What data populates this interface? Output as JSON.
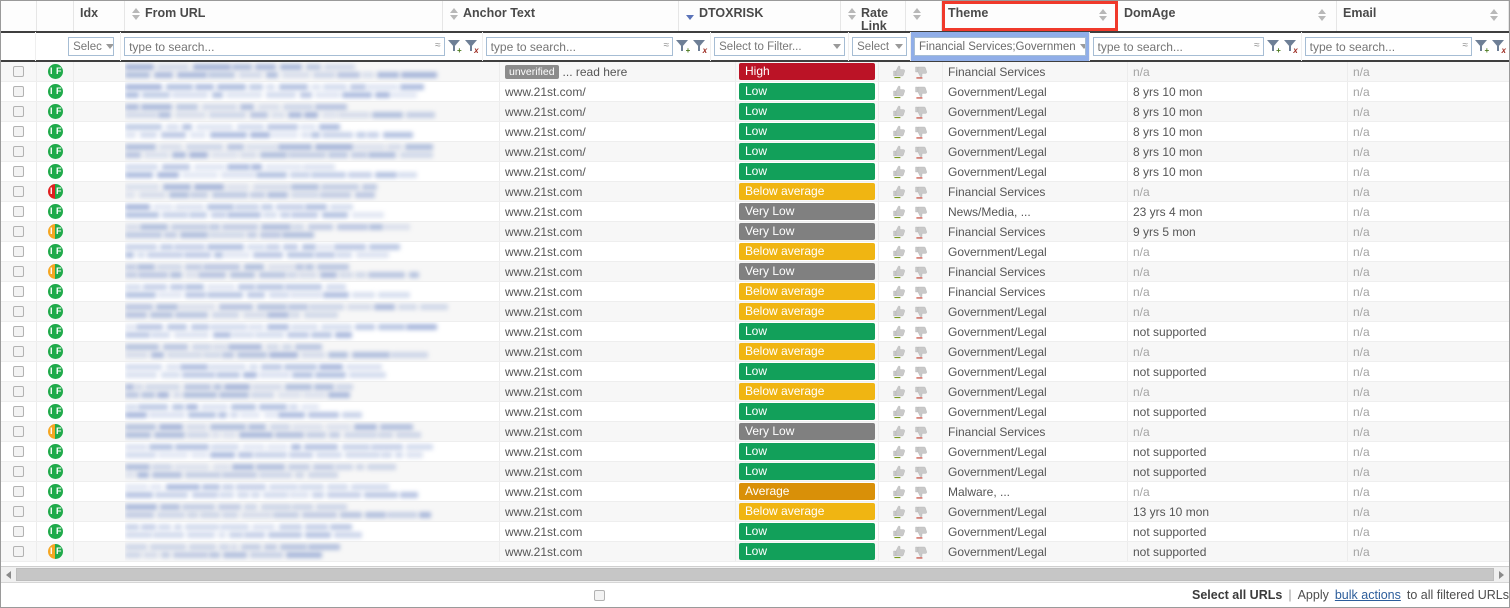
{
  "columns": [
    {
      "key": "select",
      "label": "",
      "width": 36,
      "sortable": false
    },
    {
      "key": "flags",
      "label": "",
      "width": 37,
      "sortable": false
    },
    {
      "key": "idx",
      "label": "Idx",
      "width": 0,
      "sortable": true
    },
    {
      "key": "from_url",
      "label": "From URL",
      "width": 0,
      "sortable": true
    },
    {
      "key": "anchor_text",
      "label": "Anchor Text",
      "width": 0,
      "sortable": true
    },
    {
      "key": "dtoxrisk",
      "label": "DTOXRISK",
      "width": 0,
      "sortable": true
    },
    {
      "key": "rate_link",
      "label": "Rate Link",
      "width": 0,
      "sortable": true
    },
    {
      "key": "theme",
      "label": "Theme",
      "width": 0,
      "sortable": true
    },
    {
      "key": "domage",
      "label": "DomAge",
      "width": 0,
      "sortable": true
    },
    {
      "key": "email",
      "label": "Email",
      "width": 0,
      "sortable": true
    }
  ],
  "header": {
    "idx_label": "Idx",
    "from_url_label": "From URL",
    "anchor_text_label": "Anchor Text",
    "dtoxrisk_label": "DTOXRISK",
    "rate_link_label": "Rate Link",
    "theme_label": "Theme",
    "domage_label": "DomAge",
    "email_label": "Email",
    "highlight_color": "#f0392b",
    "sorted_column": "DTOXRISK",
    "sort_direction": "desc"
  },
  "filters": {
    "idx_select": "Selec",
    "from_url_placeholder": "type to search...",
    "anchor_text_placeholder": "type to search...",
    "dtoxrisk_select": "Select to Filter...",
    "rate_link_select": "Select",
    "theme_select": "Financial Services;Governmen",
    "domage_placeholder": "type to search...",
    "email_placeholder": "type to search...",
    "fuzzy_glyph": "≈",
    "add_filter_mark": "+",
    "clear_filter_mark": "x"
  },
  "colors": {
    "risk_high": "#bb1326",
    "risk_low": "#12a05a",
    "risk_below_average": "#f0b512",
    "risk_very_low": "#808080",
    "risk_average": "#d99008",
    "flag_green": "#1faa4a",
    "flag_red": "#e02020",
    "flag_orange": "#f5a623",
    "theme_filter_bg": "#90aee8",
    "link": "#2c5d9b"
  },
  "rows": [
    {
      "flag_left": "green",
      "flag_right": "green",
      "url_blurred": true,
      "anchor_tag": "unverified",
      "anchor_text": "... read here",
      "dtoxrisk": "High",
      "risk_color": "#bb1326",
      "theme": "Financial Services",
      "domage": "n/a",
      "domage_muted": true,
      "email": "n/a"
    },
    {
      "flag_left": "green",
      "flag_right": "green",
      "url_blurred": true,
      "anchor_text": "www.21st.com/",
      "dtoxrisk": "Low",
      "risk_color": "#12a05a",
      "theme": "Government/Legal",
      "domage": "8 yrs 10 mon",
      "domage_muted": false,
      "email": "n/a"
    },
    {
      "flag_left": "green",
      "flag_right": "green",
      "url_blurred": true,
      "anchor_text": "www.21st.com/",
      "dtoxrisk": "Low",
      "risk_color": "#12a05a",
      "theme": "Government/Legal",
      "domage": "8 yrs 10 mon",
      "domage_muted": false,
      "email": "n/a"
    },
    {
      "flag_left": "green",
      "flag_right": "green",
      "url_blurred": true,
      "anchor_text": "www.21st.com/",
      "dtoxrisk": "Low",
      "risk_color": "#12a05a",
      "theme": "Government/Legal",
      "domage": "8 yrs 10 mon",
      "domage_muted": false,
      "email": "n/a"
    },
    {
      "flag_left": "green",
      "flag_right": "green",
      "url_blurred": true,
      "anchor_text": "www.21st.com/",
      "dtoxrisk": "Low",
      "risk_color": "#12a05a",
      "theme": "Government/Legal",
      "domage": "8 yrs 10 mon",
      "domage_muted": false,
      "email": "n/a"
    },
    {
      "flag_left": "green",
      "flag_right": "green",
      "url_blurred": true,
      "anchor_text": "www.21st.com/",
      "dtoxrisk": "Low",
      "risk_color": "#12a05a",
      "theme": "Government/Legal",
      "domage": "8 yrs 10 mon",
      "domage_muted": false,
      "email": "n/a"
    },
    {
      "flag_left": "red",
      "flag_right": "green",
      "url_blurred": true,
      "anchor_text": "www.21st.com",
      "dtoxrisk": "Below average",
      "risk_color": "#f0b512",
      "theme": "Financial Services",
      "domage": "n/a",
      "domage_muted": true,
      "email": "n/a"
    },
    {
      "flag_left": "green",
      "flag_right": "green",
      "url_blurred": true,
      "anchor_text": "www.21st.com",
      "dtoxrisk": "Very Low",
      "risk_color": "#808080",
      "theme": "News/Media, ...",
      "domage": "23 yrs 4 mon",
      "domage_muted": false,
      "email": "n/a"
    },
    {
      "flag_left": "orange",
      "flag_right": "green",
      "url_blurred": true,
      "anchor_text": "www.21st.com",
      "dtoxrisk": "Very Low",
      "risk_color": "#808080",
      "theme": "Financial Services",
      "domage": "9 yrs 5 mon",
      "domage_muted": false,
      "email": "n/a"
    },
    {
      "flag_left": "green",
      "flag_right": "green",
      "url_blurred": true,
      "anchor_text": "www.21st.com",
      "dtoxrisk": "Below average",
      "risk_color": "#f0b512",
      "theme": "Government/Legal",
      "domage": "n/a",
      "domage_muted": true,
      "email": "n/a"
    },
    {
      "flag_left": "orange",
      "flag_right": "green",
      "url_blurred": true,
      "anchor_text": "www.21st.com",
      "dtoxrisk": "Very Low",
      "risk_color": "#808080",
      "theme": "Financial Services",
      "domage": "n/a",
      "domage_muted": true,
      "email": "n/a"
    },
    {
      "flag_left": "green",
      "flag_right": "green",
      "url_blurred": true,
      "anchor_text": "www.21st.com",
      "dtoxrisk": "Below average",
      "risk_color": "#f0b512",
      "theme": "Financial Services",
      "domage": "n/a",
      "domage_muted": true,
      "email": "n/a"
    },
    {
      "flag_left": "green",
      "flag_right": "green",
      "url_blurred": true,
      "anchor_text": "www.21st.com",
      "dtoxrisk": "Below average",
      "risk_color": "#f0b512",
      "theme": "Government/Legal",
      "domage": "n/a",
      "domage_muted": true,
      "email": "n/a"
    },
    {
      "flag_left": "green",
      "flag_right": "green",
      "url_blurred": true,
      "anchor_text": "www.21st.com",
      "dtoxrisk": "Low",
      "risk_color": "#12a05a",
      "theme": "Government/Legal",
      "domage": "not supported",
      "domage_muted": false,
      "email": "n/a"
    },
    {
      "flag_left": "green",
      "flag_right": "green",
      "url_blurred": true,
      "anchor_text": "www.21st.com",
      "dtoxrisk": "Below average",
      "risk_color": "#f0b512",
      "theme": "Government/Legal",
      "domage": "n/a",
      "domage_muted": true,
      "email": "n/a"
    },
    {
      "flag_left": "green",
      "flag_right": "green",
      "url_blurred": true,
      "anchor_text": "www.21st.com",
      "dtoxrisk": "Low",
      "risk_color": "#12a05a",
      "theme": "Government/Legal",
      "domage": "not supported",
      "domage_muted": false,
      "email": "n/a"
    },
    {
      "flag_left": "green",
      "flag_right": "green",
      "url_blurred": true,
      "anchor_text": "www.21st.com",
      "dtoxrisk": "Below average",
      "risk_color": "#f0b512",
      "theme": "Government/Legal",
      "domage": "n/a",
      "domage_muted": true,
      "email": "n/a"
    },
    {
      "flag_left": "green",
      "flag_right": "green",
      "url_blurred": true,
      "anchor_text": "www.21st.com",
      "dtoxrisk": "Low",
      "risk_color": "#12a05a",
      "theme": "Government/Legal",
      "domage": "not supported",
      "domage_muted": false,
      "email": "n/a"
    },
    {
      "flag_left": "orange",
      "flag_right": "green",
      "url_blurred": true,
      "anchor_text": "www.21st.com",
      "dtoxrisk": "Very Low",
      "risk_color": "#808080",
      "theme": "Financial Services",
      "domage": "n/a",
      "domage_muted": true,
      "email": "n/a"
    },
    {
      "flag_left": "green",
      "flag_right": "green",
      "url_blurred": true,
      "anchor_text": "www.21st.com",
      "dtoxrisk": "Low",
      "risk_color": "#12a05a",
      "theme": "Government/Legal",
      "domage": "not supported",
      "domage_muted": false,
      "email": "n/a"
    },
    {
      "flag_left": "green",
      "flag_right": "green",
      "url_blurred": true,
      "anchor_text": "www.21st.com",
      "dtoxrisk": "Low",
      "risk_color": "#12a05a",
      "theme": "Government/Legal",
      "domage": "not supported",
      "domage_muted": false,
      "email": "n/a"
    },
    {
      "flag_left": "green",
      "flag_right": "green",
      "url_blurred": true,
      "anchor_text": "www.21st.com",
      "dtoxrisk": "Average",
      "risk_color": "#d99008",
      "theme": "Malware, ...",
      "domage": "n/a",
      "domage_muted": true,
      "email": "n/a"
    },
    {
      "flag_left": "green",
      "flag_right": "green",
      "url_blurred": true,
      "anchor_text": "www.21st.com",
      "dtoxrisk": "Below average",
      "risk_color": "#f0b512",
      "theme": "Government/Legal",
      "domage": "13 yrs 10 mon",
      "domage_muted": false,
      "email": "n/a"
    },
    {
      "flag_left": "green",
      "flag_right": "green",
      "url_blurred": true,
      "anchor_text": "www.21st.com",
      "dtoxrisk": "Low",
      "risk_color": "#12a05a",
      "theme": "Government/Legal",
      "domage": "not supported",
      "domage_muted": false,
      "email": "n/a"
    },
    {
      "flag_left": "orange",
      "flag_right": "green",
      "url_blurred": true,
      "anchor_text": "www.21st.com",
      "dtoxrisk": "Low",
      "risk_color": "#12a05a",
      "theme": "Government/Legal",
      "domage": "not supported",
      "domage_muted": false,
      "email": "n/a"
    }
  ],
  "footer": {
    "select_all_label": "Select all URLs",
    "separator": "|",
    "apply_text": "Apply",
    "bulk_actions_link": "bulk actions",
    "suffix_text": "to all filtered URLs"
  },
  "badge_letters": {
    "left": "I",
    "right": "F"
  }
}
